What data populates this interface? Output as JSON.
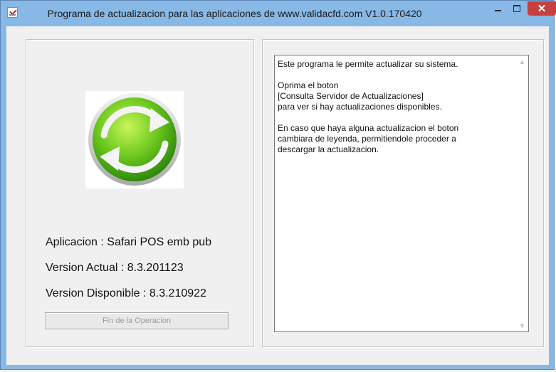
{
  "window": {
    "title": "Programa de actualizacion para las aplicaciones de www.validacfd.com V1.0.170420"
  },
  "titlebar_buttons": {
    "close_glyph": "✕"
  },
  "logo": {
    "icon": "sync-arrows-icon",
    "colors": {
      "green_dark": "#3f9f12",
      "green_light": "#b7ee4a",
      "arrow": "#e8e8e8"
    }
  },
  "info": {
    "aplicacion": "Aplicacion : Safari POS emb pub",
    "version_actual": "Version Actual : 8.3.201123",
    "version_disponible": "Version Disponible : 8.3.210922"
  },
  "button": {
    "label": "Fin de la Operacion",
    "enabled": false
  },
  "textbox": {
    "line1": "Este programa le permite actualizar su sistema.",
    "line2": "Oprima el boton",
    "line3": "[Consulta Servidor de Actualizaciones]",
    "line4": "para ver si hay actualizaciones disponibles.",
    "line5": "En caso que haya alguna actualizacion el boton",
    "line6": "cambiara de leyenda, permitiendole proceder a",
    "line7": "descargar la actualizacion."
  },
  "scrollbar": {
    "up_glyph": "▲",
    "down_glyph": "▼"
  }
}
